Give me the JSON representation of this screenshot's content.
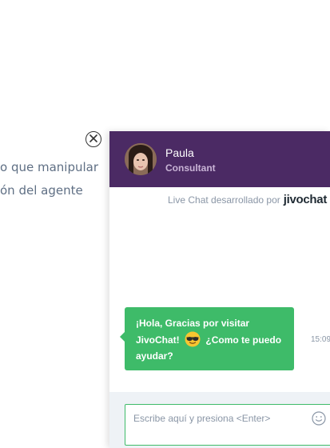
{
  "background": {
    "line1": "o que manipular",
    "line2": "ón del agente"
  },
  "chat": {
    "agent": {
      "name": "Paula",
      "role": "Consultant"
    },
    "powered_by": {
      "text": "Live Chat desarrollado por",
      "brand": "jivochat"
    },
    "message": {
      "part1": "¡Hola, Gracias por visitar JivoChat!",
      "emoji": "smiling-face-with-sunglasses",
      "part2": "¿Como te puedo ayudar?",
      "time": "15:09"
    },
    "input": {
      "placeholder": "Escribe aquí y presiona <Enter>",
      "value": ""
    }
  },
  "colors": {
    "header": "#4b2a64",
    "bubble": "#3ebb69",
    "input_area": "#eef2f6"
  }
}
